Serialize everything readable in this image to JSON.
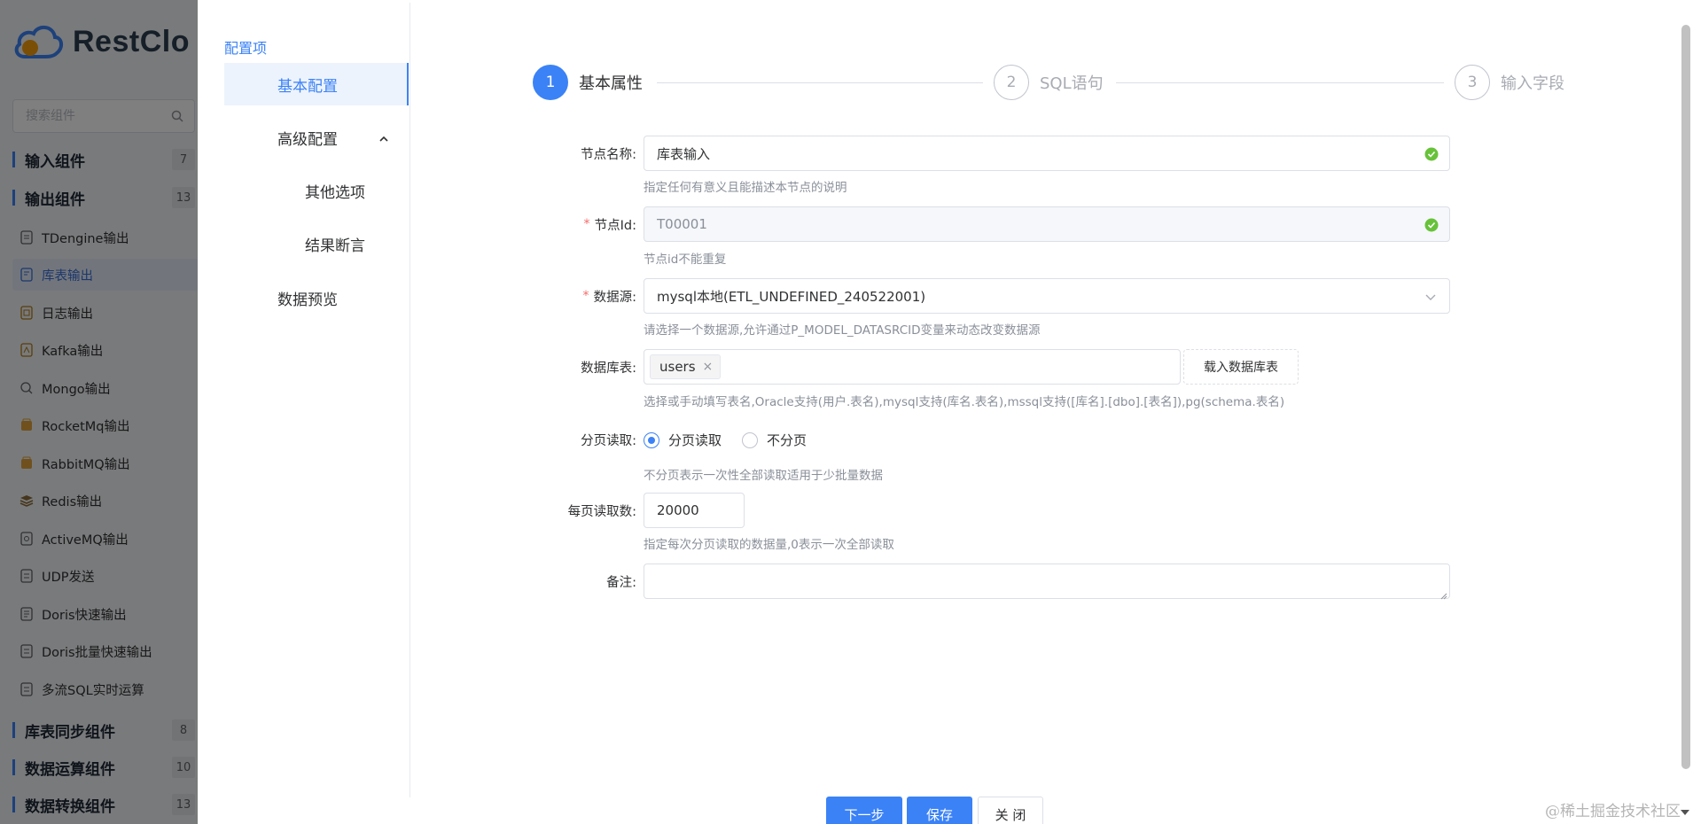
{
  "app": {
    "logo_text": "RestClo",
    "search_placeholder": "搜索组件",
    "groups": [
      {
        "label": "输入组件",
        "count": "7"
      },
      {
        "label": "输出组件",
        "count": "13"
      },
      {
        "label": "库表同步组件",
        "count": "8"
      },
      {
        "label": "数据运算组件",
        "count": "10"
      },
      {
        "label": "数据转换组件",
        "count": "13"
      }
    ],
    "output_items": [
      "TDengine输出",
      "库表输出",
      "日志输出",
      "Kafka输出",
      "Mongo输出",
      "RocketMq输出",
      "RabbitMQ输出",
      "Redis输出",
      "ActiveMQ输出",
      "UDP发送",
      "Doris快速输出",
      "Doris批量快速输出",
      "多流SQL实时运算"
    ]
  },
  "config_nav": {
    "title": "配置项",
    "items": [
      "基本配置",
      "高级配置",
      "其他选项",
      "结果断言",
      "数据预览"
    ]
  },
  "steps": [
    {
      "num": "1",
      "label": "基本属性"
    },
    {
      "num": "2",
      "label": "SQL语句"
    },
    {
      "num": "3",
      "label": "输入字段"
    }
  ],
  "form": {
    "node_name": {
      "label": "节点名称:",
      "value": "库表输入",
      "hint": "指定任何有意义且能描述本节点的说明"
    },
    "node_id": {
      "label": "节点Id:",
      "value": "T00001",
      "hint": "节点id不能重复"
    },
    "datasource": {
      "label": "数据源:",
      "value": "mysql本地(ETL_UNDEFINED_240522001)",
      "hint": "请选择一个数据源,允许通过P_MODEL_DATASRCID变量来动态改变数据源"
    },
    "table": {
      "label": "数据库表:",
      "tag": "users",
      "tag_close": "×",
      "load_button": "载入数据库表",
      "hint": "选择或手动填写表名,Oracle支持(用户.表名),mysql支持(库名.表名),mssql支持([库名].[dbo].[表名]),pg(schema.表名)"
    },
    "paging": {
      "label": "分页读取:",
      "option_on": "分页读取",
      "option_off": "不分页",
      "hint": "不分页表示一次性全部读取适用于少批量数据"
    },
    "page_size": {
      "label": "每页读取数:",
      "value": "20000",
      "hint": "指定每次分页读取的数据量,0表示一次全部读取"
    },
    "remark": {
      "label": "备注:"
    }
  },
  "footer": {
    "next": "下一步",
    "save": "保存",
    "close": "关 闭"
  },
  "watermark": "@稀土掘金技术社区",
  "colors": {
    "primary": "#3b82f6",
    "success": "#67c23a",
    "required": "#f56c6c"
  }
}
